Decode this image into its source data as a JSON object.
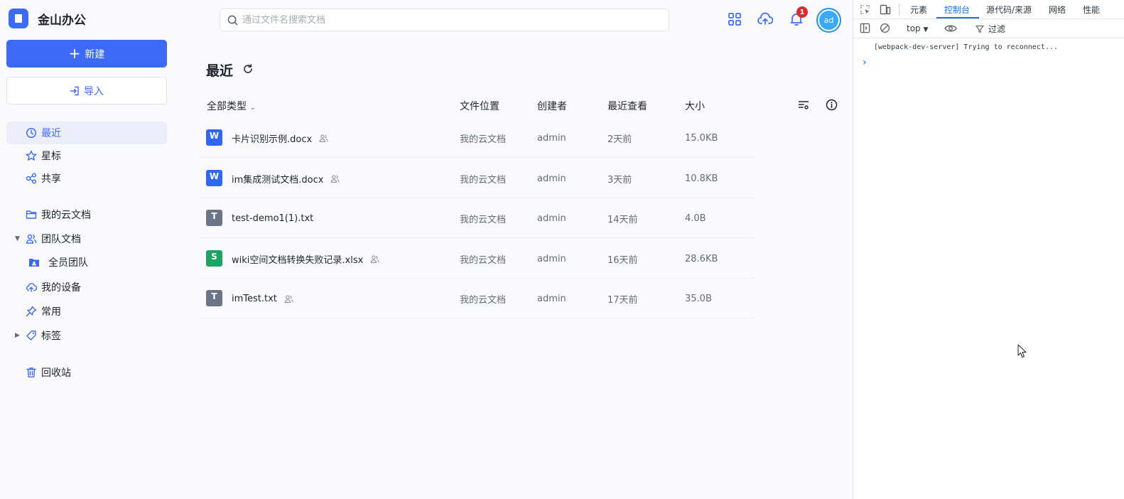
{
  "brand": {
    "name": "金山办公"
  },
  "sidebar": {
    "new_label": "新建",
    "import_label": "导入",
    "items": [
      {
        "label": "最近"
      },
      {
        "label": "星标"
      },
      {
        "label": "共享"
      },
      {
        "label": "我的云文档"
      },
      {
        "label": "团队文档"
      },
      {
        "label": "全员团队"
      },
      {
        "label": "我的设备"
      },
      {
        "label": "常用"
      },
      {
        "label": "标签"
      },
      {
        "label": "回收站"
      }
    ]
  },
  "header": {
    "search_placeholder": "通过文件名搜索文档",
    "notification_count": "1",
    "avatar_text": "ad"
  },
  "main": {
    "title": "最近",
    "columns": {
      "type_filter": "全部类型",
      "location": "文件位置",
      "creator": "创建者",
      "viewed": "最近查看",
      "size": "大小"
    },
    "files": [
      {
        "icon_letter": "W",
        "icon_color": "#2f66f2",
        "name": "卡片识别示例.docx",
        "location": "我的云文档",
        "creator": "admin",
        "viewed": "2天前",
        "size": "15.0KB"
      },
      {
        "icon_letter": "W",
        "icon_color": "#2f66f2",
        "name": "im集成测试文档.docx",
        "location": "我的云文档",
        "creator": "admin",
        "viewed": "3天前",
        "size": "10.8KB"
      },
      {
        "icon_letter": "T",
        "icon_color": "#6b7585",
        "name": "test-demo1(1).txt",
        "location": "我的云文档",
        "creator": "admin",
        "viewed": "14天前",
        "size": "4.0B"
      },
      {
        "icon_letter": "S",
        "icon_color": "#1ba364",
        "name": "wiki空间文档转换失败记录.xlsx",
        "location": "我的云文档",
        "creator": "admin",
        "viewed": "16天前",
        "size": "28.6KB"
      },
      {
        "icon_letter": "T",
        "icon_color": "#6b7585",
        "name": "imTest.txt",
        "location": "我的云文档",
        "creator": "admin",
        "viewed": "17天前",
        "size": "35.0B"
      }
    ]
  },
  "devtools": {
    "tabs": [
      "元素",
      "控制台",
      "源代码/来源",
      "网络",
      "性能"
    ],
    "context": "top",
    "filter_label": "过滤",
    "console_message": "[webpack-dev-server] Trying to reconnect..."
  },
  "colors": {
    "accent": "#3c6af6",
    "badge": "#d92b2b"
  }
}
